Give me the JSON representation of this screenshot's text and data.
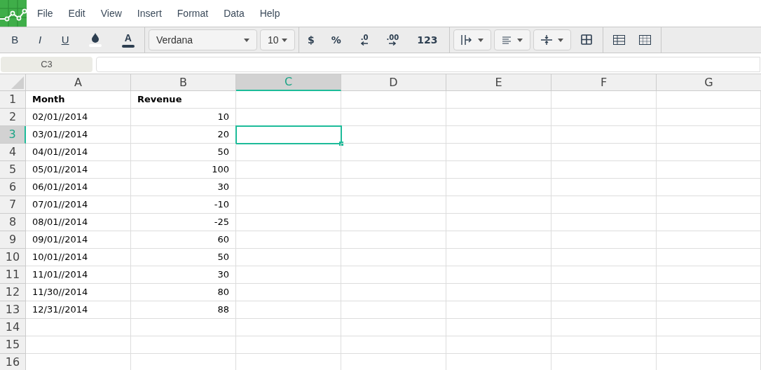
{
  "menu": [
    "File",
    "Edit",
    "View",
    "Insert",
    "Format",
    "Data",
    "Help"
  ],
  "toolbar": {
    "bold": "B",
    "italic": "I",
    "underline": "U",
    "text_color": "A",
    "font": "Verdana",
    "font_size": "10",
    "currency": "$",
    "percent": "%",
    "decrease_decimals": ".0",
    "increase_decimals": ".00",
    "number_format": "123"
  },
  "formula_bar": {
    "cell_ref": "C3"
  },
  "columns": [
    {
      "label": "A",
      "selected": false
    },
    {
      "label": "B",
      "selected": false
    },
    {
      "label": "C",
      "selected": true
    },
    {
      "label": "D",
      "selected": false
    },
    {
      "label": "E",
      "selected": false
    },
    {
      "label": "F",
      "selected": false
    },
    {
      "label": "G",
      "selected": false
    }
  ],
  "rows": [
    {
      "label": "1",
      "selected": false,
      "kind": "header",
      "cells": [
        "Month",
        "Revenue"
      ]
    },
    {
      "label": "2",
      "selected": false,
      "kind": "data",
      "cells": [
        "02/01//2014",
        "10"
      ]
    },
    {
      "label": "3",
      "selected": true,
      "kind": "data",
      "cells": [
        "03/01//2014",
        "20"
      ]
    },
    {
      "label": "4",
      "selected": false,
      "kind": "data",
      "cells": [
        "04/01//2014",
        "50"
      ]
    },
    {
      "label": "5",
      "selected": false,
      "kind": "data",
      "cells": [
        "05/01//2014",
        "100"
      ]
    },
    {
      "label": "6",
      "selected": false,
      "kind": "data",
      "cells": [
        "06/01//2014",
        "30"
      ]
    },
    {
      "label": "7",
      "selected": false,
      "kind": "data",
      "cells": [
        "07/01//2014",
        "-10"
      ]
    },
    {
      "label": "8",
      "selected": false,
      "kind": "data",
      "cells": [
        "08/01//2014",
        "-25"
      ]
    },
    {
      "label": "9",
      "selected": false,
      "kind": "data",
      "cells": [
        "09/01//2014",
        "60"
      ]
    },
    {
      "label": "10",
      "selected": false,
      "kind": "data",
      "cells": [
        "10/01//2014",
        "50"
      ]
    },
    {
      "label": "11",
      "selected": false,
      "kind": "data",
      "cells": [
        "11/01//2014",
        "30"
      ]
    },
    {
      "label": "12",
      "selected": false,
      "kind": "data",
      "cells": [
        "11/30//2014",
        "80"
      ]
    },
    {
      "label": "13",
      "selected": false,
      "kind": "data",
      "cells": [
        "12/31//2014",
        "88"
      ]
    },
    {
      "label": "14",
      "selected": false,
      "kind": "data",
      "cells": []
    },
    {
      "label": "15",
      "selected": false,
      "kind": "data",
      "cells": []
    },
    {
      "label": "16",
      "selected": false,
      "kind": "data",
      "cells": []
    }
  ]
}
